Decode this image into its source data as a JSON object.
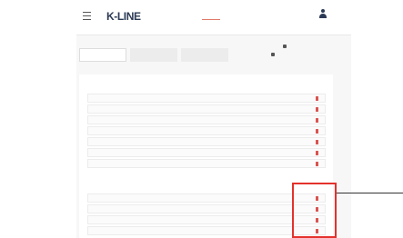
{
  "header": {
    "brand_name": "K-LINE",
    "brand_tagline": "",
    "nav_items": [
      {
        "label": "",
        "active": true
      },
      {
        "label": "",
        "active": false
      }
    ],
    "brand_badge": "",
    "user_label": ""
  },
  "tabs": [
    {
      "label": "",
      "active": true
    },
    {
      "label": "",
      "active": false
    },
    {
      "label": "",
      "active": false
    }
  ],
  "side_links": [
    {
      "label": "",
      "icon": "document-icon"
    },
    {
      "label": "",
      "icon": "download-icon"
    }
  ],
  "sections": [
    {
      "title": "",
      "rows": [
        {
          "label": "",
          "file_label": ""
        },
        {
          "label": "",
          "file_label": ""
        },
        {
          "label": "",
          "file_label": ""
        },
        {
          "label": "",
          "file_label": ""
        },
        {
          "label": "",
          "file_label": ""
        },
        {
          "label": "",
          "file_label": ""
        },
        {
          "label": "",
          "file_label": ""
        }
      ]
    },
    {
      "title": "",
      "rows": [
        {
          "label": "",
          "file_label": ""
        },
        {
          "label": "",
          "file_label": ""
        },
        {
          "label": "",
          "file_label": ""
        },
        {
          "label": "",
          "file_label": ""
        }
      ]
    }
  ],
  "colors": {
    "brand": "#2b3a55",
    "accent": "#e4312b",
    "pdf": "#d9534f"
  }
}
